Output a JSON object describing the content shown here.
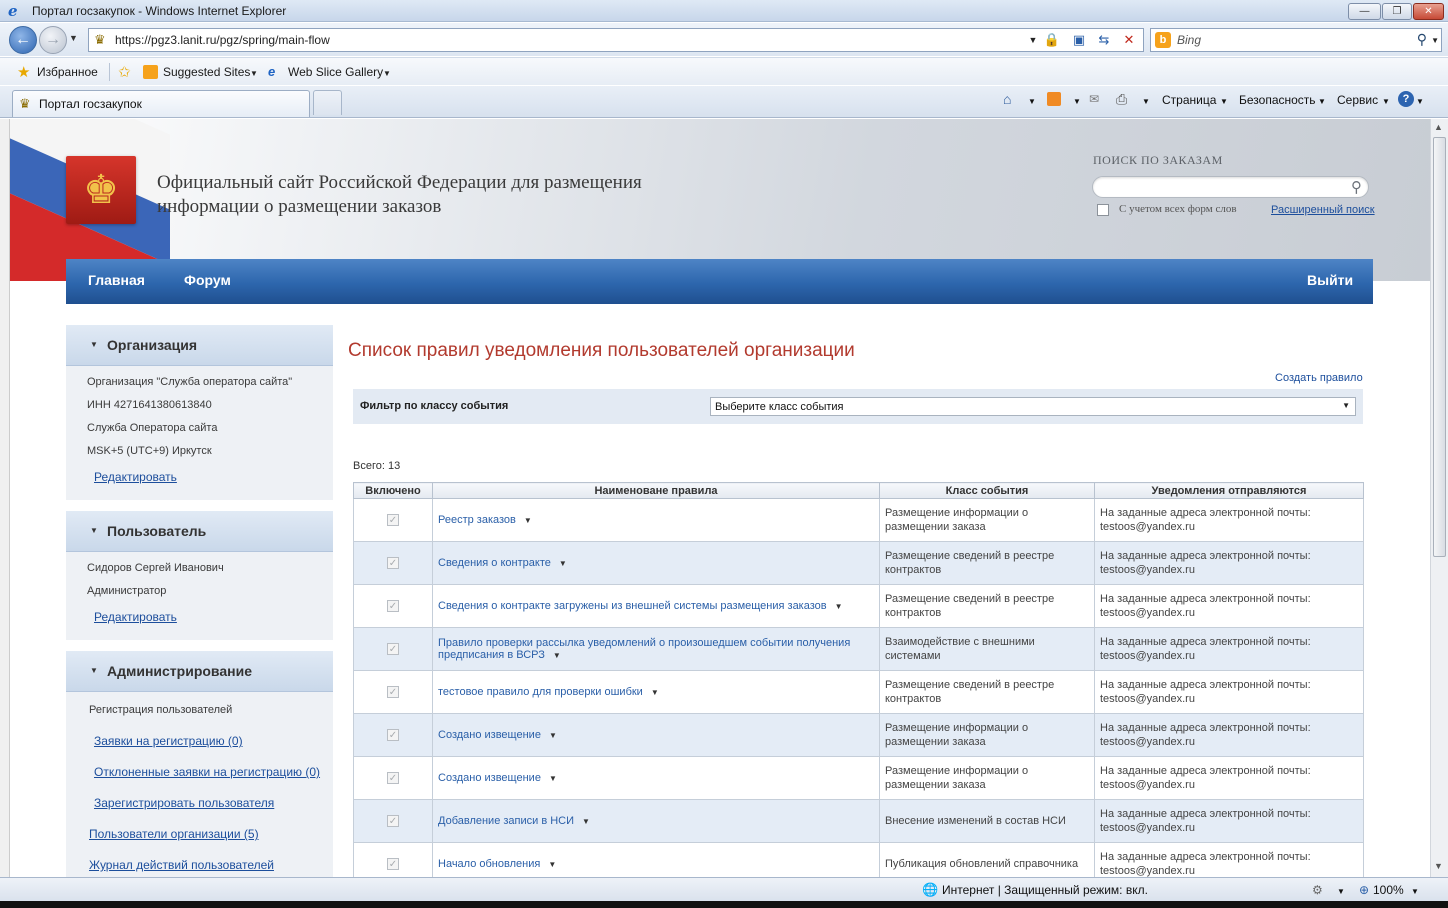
{
  "browser": {
    "window_title": "Портал госзакупок - Windows Internet Explorer",
    "url": "https://pgz3.lanit.ru/pgz/spring/main-flow",
    "search_placeholder": "Bing",
    "favorites_label": "Избранное",
    "suggested_sites": "Suggested Sites",
    "web_slice": "Web Slice Gallery",
    "tab_title": "Портал госзакупок",
    "cmd_page": "Страница",
    "cmd_security": "Безопасность",
    "cmd_service": "Сервис",
    "status_zone": "Интернет | Защищенный режим: вкл.",
    "zoom": "100%"
  },
  "header": {
    "site_title": "Официальный сайт Российской Федерации для размещения информации о размещении заказов",
    "search_label": "ПОИСК ПО ЗАКАЗАМ",
    "search_value": "",
    "all_forms_label": "С учетом всех форм слов",
    "advanced_search": "Расширенный поиск"
  },
  "nav": {
    "home": "Главная",
    "forum": "Форум",
    "logout": "Выйти"
  },
  "sidebar": {
    "org": {
      "title": "Организация",
      "lines": [
        "Организация \"Служба оператора сайта\"",
        "ИНН 4271641380613840",
        "Служба Оператора сайта",
        "MSK+5 (UTC+9) Иркутск"
      ],
      "edit": "Редактировать"
    },
    "user": {
      "title": "Пользователь",
      "lines": [
        "Сидоров Сергей Иванович",
        "Администратор"
      ],
      "edit": "Редактировать"
    },
    "admin": {
      "title": "Администрирование",
      "reg_label": "Регистрация пользователей",
      "links": [
        "Заявки на регистрацию (0)",
        "Отклоненные заявки на регистрацию (0)",
        "Зарегистрировать пользователя"
      ],
      "org_users": "Пользователи организации (5)",
      "journal": "Журнал действий пользователей"
    }
  },
  "main": {
    "title": "Список правил уведомления пользователей организации",
    "create_rule": "Создать правило",
    "filter_label": "Фильтр по классу события",
    "filter_value": "Выберите класс события",
    "total": "Всего: 13",
    "columns": [
      "Включено",
      "Наименоване правила",
      "Класс события",
      "Уведомления отправляются"
    ],
    "rows": [
      {
        "name": "Реестр заказов",
        "cls": "Размещение информации о размещении заказа",
        "notify": "На заданные адреса электронной почты: testoos@yandex.ru"
      },
      {
        "name": "Сведения о контракте",
        "cls": "Размещение сведений в реестре контрактов",
        "notify": "На заданные адреса электронной почты: testoos@yandex.ru"
      },
      {
        "name": "Сведения о контракте загружены из внешней системы размещения заказов",
        "cls": "Размещение сведений в реестре контрактов",
        "notify": "На заданные адреса электронной почты: testoos@yandex.ru"
      },
      {
        "name": "Правило проверки рассылка уведомлений о произошедшем событии получения предписания в ВСРЗ",
        "cls": "Взаимодействие с внешними системами",
        "notify": "На заданные адреса электронной почты: testoos@yandex.ru"
      },
      {
        "name": "тестовое правило для проверки ошибки",
        "cls": "Размещение сведений в реестре контрактов",
        "notify": "На заданные адреса электронной почты: testoos@yandex.ru"
      },
      {
        "name": "Создано извещение",
        "cls": "Размещение информации о размещении заказа",
        "notify": "На заданные адреса электронной почты: testoos@yandex.ru"
      },
      {
        "name": "Создано извещение",
        "cls": "Размещение информации о размещении заказа",
        "notify": "На заданные адреса электронной почты: testoos@yandex.ru"
      },
      {
        "name": "Добавление записи в НСИ",
        "cls": "Внесение изменений в состав НСИ",
        "notify": "На заданные адреса электронной почты: testoos@yandex.ru"
      },
      {
        "name": "Начало обновления",
        "cls": "Публикация обновлений справочника",
        "notify": "На заданные адреса электронной почты: testoos@yandex.ru"
      }
    ]
  }
}
